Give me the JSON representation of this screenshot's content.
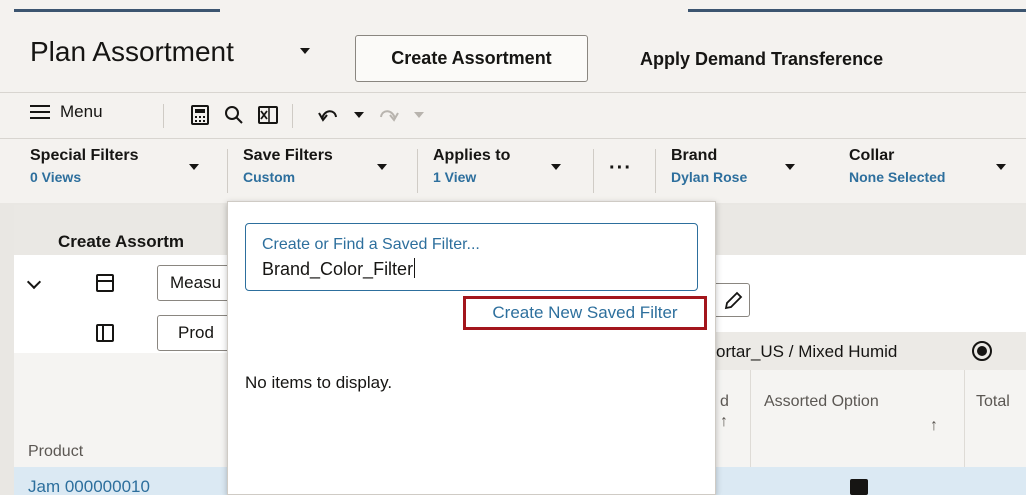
{
  "header": {
    "title": "Plan Assortment",
    "create_assortment_label": "Create Assortment",
    "apply_demand_label": "Apply Demand Transference"
  },
  "toolbar": {
    "menu_label": "Menu"
  },
  "filters": [
    {
      "label": "Special Filters",
      "value": "0 Views"
    },
    {
      "label": "Save Filters",
      "value": "Custom"
    },
    {
      "label": "Applies to",
      "value": "1 View"
    },
    {
      "label": "Brand",
      "value": "Dylan Rose"
    },
    {
      "label": "Collar",
      "value": "None Selected"
    }
  ],
  "panel": {
    "title": "Create Assortm",
    "measure_select": "Measu",
    "product_select": "Prod",
    "location_text": "ortar_US / Mixed Humid",
    "columns": {
      "partial_left": "d",
      "assorted_option": "Assorted Option",
      "total": "Total",
      "product": "Product"
    },
    "row_partial": "Jam 000000010"
  },
  "popup": {
    "search_placeholder": "Create or Find a Saved Filter...",
    "search_value": "Brand_Color_Filter",
    "create_new_label": "Create New Saved Filter",
    "empty_text": "No items to display."
  },
  "colors": {
    "link_blue": "#2d6f9d",
    "highlight_red": "#a3161c",
    "header_bar": "#3c5570"
  }
}
